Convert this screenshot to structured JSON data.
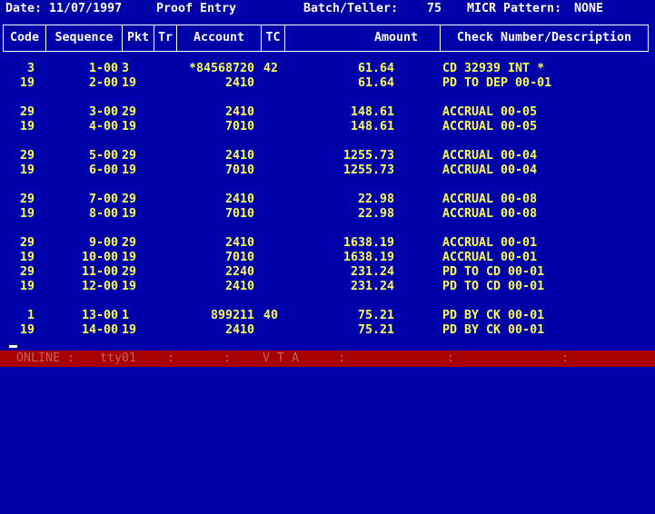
{
  "topbar": {
    "date": "Date: 11/07/1997",
    "screen": "Proof Entry",
    "batch_teller_label": "Batch/Teller:",
    "batch_teller_value": "75",
    "micr_label": "MICR Pattern:",
    "micr_value": "NONE"
  },
  "columns": [
    "Code",
    "Sequence",
    "Pkt",
    "Tr",
    "Account",
    "TC",
    "Amount",
    "Check Number/Description"
  ],
  "rows": [
    {
      "code": "3",
      "seq": "1-00",
      "pkt": "3",
      "tr": "",
      "acct": "*84568720",
      "tc": "42",
      "amt": "61.64",
      "desc": "CD 32939 INT *"
    },
    {
      "code": "19",
      "seq": "2-00",
      "pkt": "19",
      "tr": "",
      "acct": "2410",
      "tc": "",
      "amt": "61.64",
      "desc": "PD TO DEP 00-01"
    },
    {
      "code": "29",
      "seq": "3-00",
      "pkt": "29",
      "tr": "",
      "acct": "2410",
      "tc": "",
      "amt": "148.61",
      "desc": "ACCRUAL 00-05"
    },
    {
      "code": "19",
      "seq": "4-00",
      "pkt": "19",
      "tr": "",
      "acct": "7010",
      "tc": "",
      "amt": "148.61",
      "desc": "ACCRUAL 00-05"
    },
    {
      "code": "29",
      "seq": "5-00",
      "pkt": "29",
      "tr": "",
      "acct": "2410",
      "tc": "",
      "amt": "1255.73",
      "desc": "ACCRUAL 00-04"
    },
    {
      "code": "19",
      "seq": "6-00",
      "pkt": "19",
      "tr": "",
      "acct": "7010",
      "tc": "",
      "amt": "1255.73",
      "desc": "ACCRUAL 00-04"
    },
    {
      "code": "29",
      "seq": "7-00",
      "pkt": "29",
      "tr": "",
      "acct": "2410",
      "tc": "",
      "amt": "22.98",
      "desc": "ACCRUAL 00-08"
    },
    {
      "code": "19",
      "seq": "8-00",
      "pkt": "19",
      "tr": "",
      "acct": "7010",
      "tc": "",
      "amt": "22.98",
      "desc": "ACCRUAL 00-08"
    },
    {
      "code": "29",
      "seq": "9-00",
      "pkt": "29",
      "tr": "",
      "acct": "2410",
      "tc": "",
      "amt": "1638.19",
      "desc": "ACCRUAL 00-01"
    },
    {
      "code": "19",
      "seq": "10-00",
      "pkt": "19",
      "tr": "",
      "acct": "7010",
      "tc": "",
      "amt": "1638.19",
      "desc": "ACCRUAL 00-01"
    },
    {
      "code": "29",
      "seq": "11-00",
      "pkt": "29",
      "tr": "",
      "acct": "2240",
      "tc": "",
      "amt": "231.24",
      "desc": "PD TO CD 00-01"
    },
    {
      "code": "19",
      "seq": "12-00",
      "pkt": "19",
      "tr": "",
      "acct": "2410",
      "tc": "",
      "amt": "231.24",
      "desc": "PD TO CD 00-01"
    },
    {
      "code": "1",
      "seq": "13-00",
      "pkt": "1",
      "tr": "",
      "acct": "899211",
      "tc": "40",
      "amt": "75.21",
      "desc": "PD BY CK 00-01"
    },
    {
      "code": "19",
      "seq": "14-00",
      "pkt": "19",
      "tr": "",
      "acct": "2410",
      "tc": "",
      "amt": "75.21",
      "desc": "PD BY CK 00-01"
    }
  ],
  "status": {
    "online": "ONLINE",
    "tty": "tty01",
    "vta": "V T A"
  }
}
